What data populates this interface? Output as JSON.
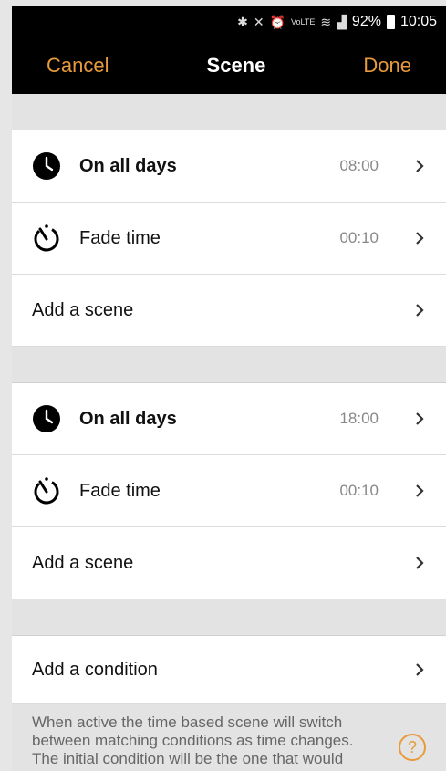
{
  "status": {
    "battery": "92%",
    "time": "10:05",
    "icons": [
      "bluetooth-icon",
      "mute-icon",
      "alarm-icon",
      "volte-icon",
      "wifi-icon",
      "signal-icon"
    ],
    "volte_label": "VoLTE"
  },
  "appbar": {
    "cancel_label": "Cancel",
    "title": "Scene",
    "done_label": "Done"
  },
  "sections": [
    {
      "schedule": {
        "label": "On all days",
        "value": "08:00"
      },
      "fade": {
        "label": "Fade time",
        "value": "00:10"
      },
      "add_scene_label": "Add a scene"
    },
    {
      "schedule": {
        "label": "On all days",
        "value": "18:00"
      },
      "fade": {
        "label": "Fade time",
        "value": "00:10"
      },
      "add_scene_label": "Add a scene"
    }
  ],
  "add_condition_label": "Add a condition",
  "description": "When active the time based scene will switch between matching conditions as time changes. The initial condition will be the one that would have",
  "help_label": "?",
  "colors": {
    "accent": "#e89a3c",
    "appbar": "#000000"
  }
}
